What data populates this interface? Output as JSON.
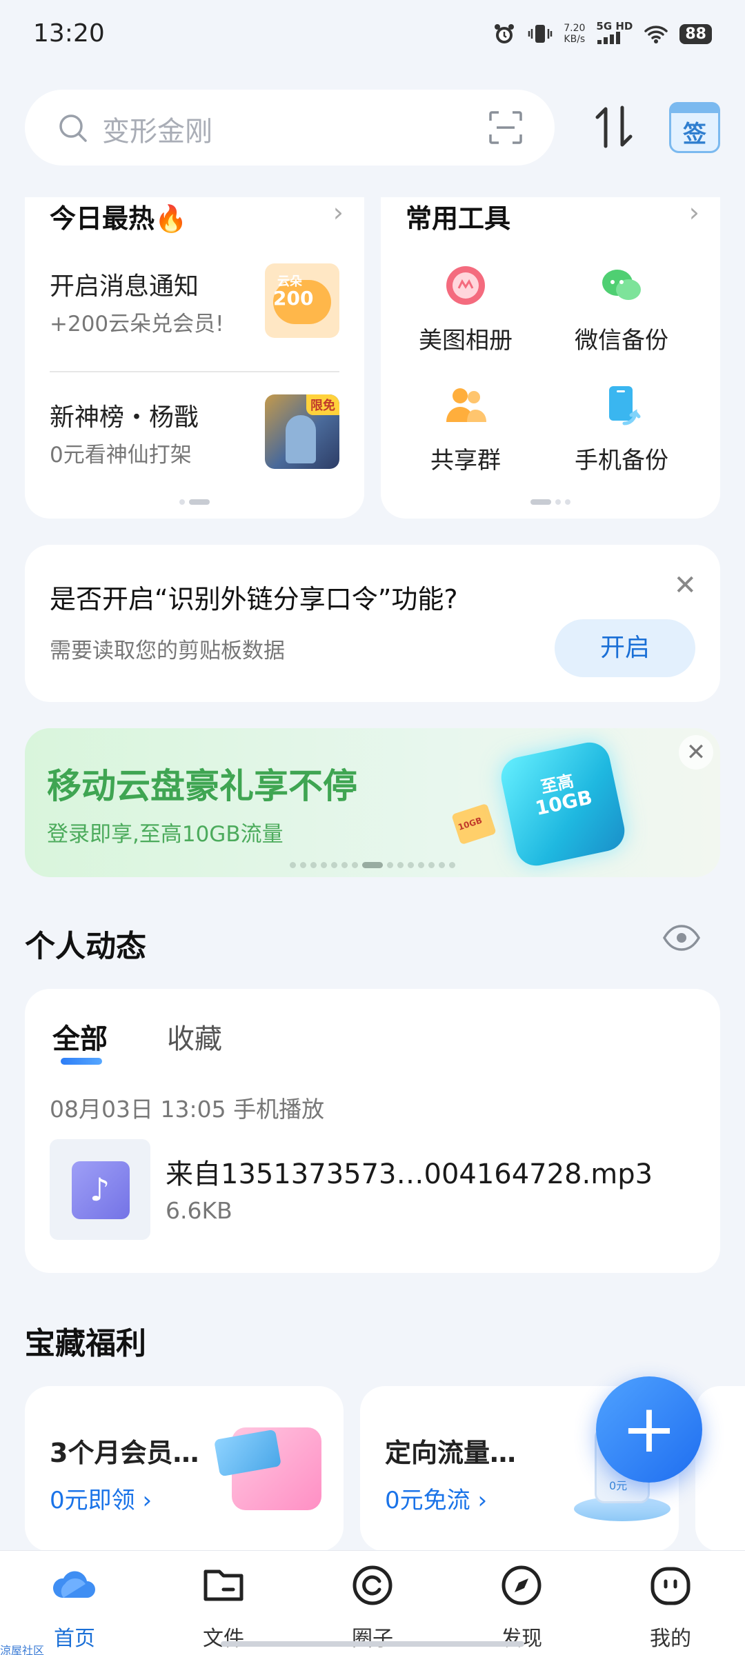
{
  "status_bar": {
    "time": "13:20",
    "speed_value": "7.20",
    "speed_unit": "KB/s",
    "network": "5G HD",
    "battery": "88"
  },
  "search": {
    "placeholder": "变形金刚"
  },
  "header": {
    "sign_label": "签"
  },
  "hot_today": {
    "title": "今日最热",
    "items": [
      {
        "title": "开启消息通知",
        "subtitle": "+200云朵兑会员!",
        "badge_top": "云朵",
        "badge_num": "200"
      },
      {
        "title": "新神榜・杨戬",
        "subtitle": "0元看神仙打架",
        "tag": "限免"
      }
    ]
  },
  "tools": {
    "title": "常用工具",
    "items": [
      {
        "label": "美图相册",
        "icon": "meitu-album-icon"
      },
      {
        "label": "微信备份",
        "icon": "wechat-backup-icon"
      },
      {
        "label": "共享群",
        "icon": "shared-group-icon"
      },
      {
        "label": "手机备份",
        "icon": "phone-backup-icon"
      }
    ]
  },
  "share_prompt": {
    "title": "是否开启“识别外链分享口令”功能?",
    "subtitle": "需要读取您的剪贴板数据",
    "button": "开启"
  },
  "banner": {
    "title": "移动云盘豪礼享不停",
    "subtitle": "登录即享,至高10GB流量",
    "cube_line1": "至高",
    "cube_line2": "10GB",
    "ticket": "10GB"
  },
  "activity": {
    "section_title": "个人动态",
    "tabs": [
      "全部",
      "收藏"
    ],
    "entry": {
      "meta": "08月03日 13:05   手机播放",
      "file_name": "来自1351373573…004164728.mp3",
      "file_size": "6.6KB"
    }
  },
  "benefits": {
    "section_title": "宝藏福利",
    "items": [
      {
        "title": "3个月会员…",
        "link": "0元即领"
      },
      {
        "title": "定向流量…",
        "link": "0元免流",
        "badge": "0元"
      }
    ]
  },
  "bottom_nav": {
    "items": [
      {
        "label": "首页",
        "active": true
      },
      {
        "label": "文件",
        "active": false
      },
      {
        "label": "圈子",
        "active": false
      },
      {
        "label": "发现",
        "active": false
      },
      {
        "label": "我的",
        "active": false
      }
    ]
  },
  "watermark": "涼屋社区",
  "colors": {
    "primary": "#1a6fd6",
    "background": "#f2f5fa",
    "banner_green": "#3fa552"
  }
}
